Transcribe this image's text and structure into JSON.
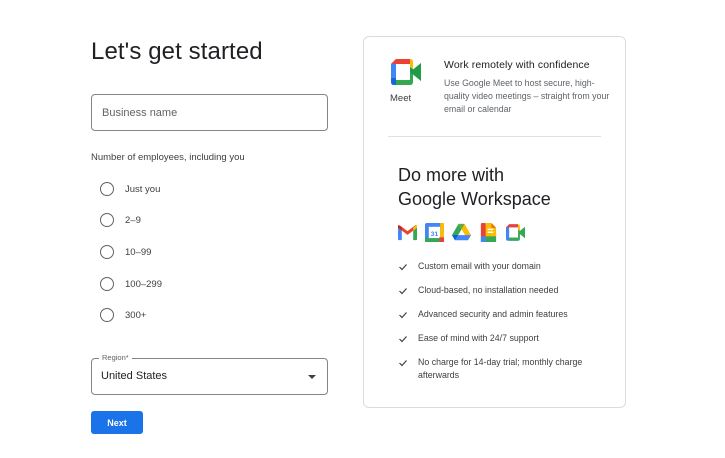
{
  "form": {
    "title": "Let's get started",
    "business_name_placeholder": "Business name",
    "employees_label": "Number of employees, including you",
    "employee_options": [
      "Just you",
      "2–9",
      "10–99",
      "100–299",
      "300+"
    ],
    "region_label": "Region*",
    "region_value": "United States",
    "next_label": "Next"
  },
  "promo": {
    "meet_caption": "Meet",
    "meet_title": "Work remotely with confidence",
    "meet_description": "Use Google Meet to host secure, high-quality video meetings – straight from your email or calendar",
    "workspace_heading_line1": "Do more with",
    "workspace_heading_line2": "Google Workspace",
    "app_icons": [
      "gmail-icon",
      "calendar-icon",
      "drive-icon",
      "docs-icon",
      "meet-icon"
    ],
    "calendar_day": "31",
    "features": [
      "Custom email with your domain",
      "Cloud-based, no installation needed",
      "Advanced security and admin features",
      "Ease of mind with 24/7 support",
      "No charge for 14-day trial; monthly charge afterwards"
    ]
  },
  "colors": {
    "primary_button": "#1a73e8",
    "google_blue": "#4285f4",
    "google_red": "#ea4335",
    "google_yellow": "#fbbc04",
    "google_green": "#34a853"
  }
}
